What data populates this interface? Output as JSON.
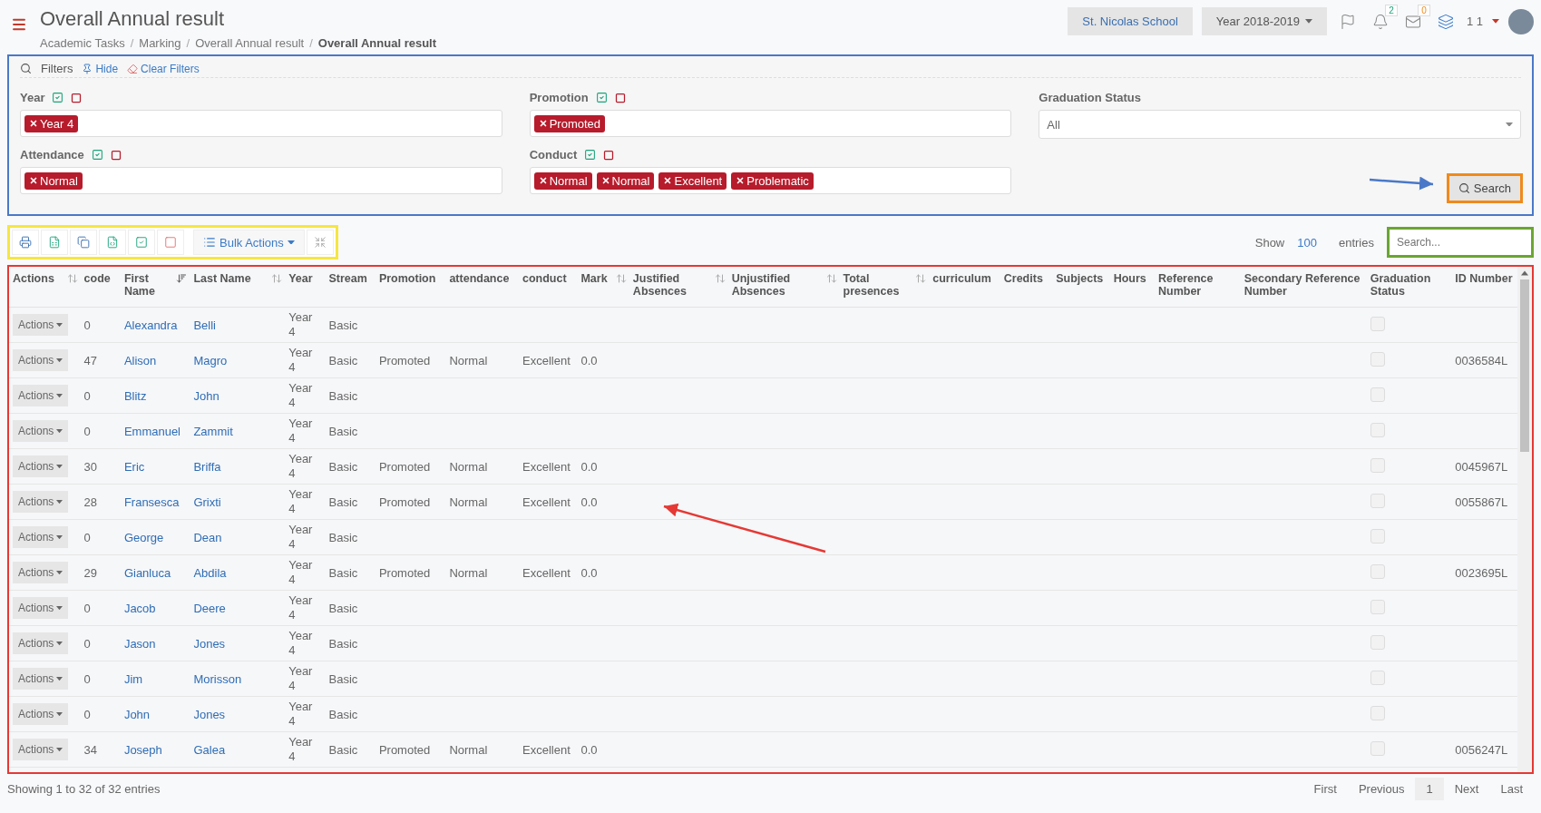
{
  "header": {
    "title": "Overall Annual result",
    "breadcrumbs": [
      {
        "label": "Academic Tasks",
        "current": false
      },
      {
        "separator": "/",
        "label": "Marking",
        "current": false
      },
      {
        "separator": "/",
        "label": "Overall Annual result",
        "current": false
      },
      {
        "separator": "/",
        "label": "Overall Annual result",
        "current": true
      }
    ],
    "school": "St. Nicolas School",
    "year": "Year 2018-2019",
    "notifications": "2",
    "messages": "0",
    "user": "1 1"
  },
  "filters": {
    "title": "Filters",
    "hide": "Hide",
    "clear": "Clear Filters",
    "search_button": "Search",
    "fields": [
      {
        "kind": "tags",
        "label": "Year",
        "tags": [
          "Year 4"
        ]
      },
      {
        "kind": "tags",
        "label": "Promotion",
        "tags": [
          "Promoted"
        ]
      },
      {
        "kind": "select",
        "label": "Graduation Status",
        "value": "All"
      },
      {
        "kind": "tags",
        "label": "Attendance",
        "tags": [
          "Normal"
        ]
      },
      {
        "kind": "tags",
        "label": "Conduct",
        "tags": [
          "Normal",
          "Normal",
          "Excellent",
          "Problematic"
        ]
      }
    ]
  },
  "toolbar": {
    "bulk_actions": "Bulk Actions",
    "show_label": "Show",
    "page_size": "100",
    "entries_label": "entries",
    "search": {
      "placeholder": "Search..."
    }
  },
  "table": {
    "columns": [
      {
        "label": "Actions",
        "sortable": true,
        "sorted": false
      },
      {
        "label": "code",
        "sortable": false
      },
      {
        "label": "First Name",
        "sortable": true,
        "sorted": true
      },
      {
        "label": "Last Name",
        "sortable": true,
        "sorted": false
      },
      {
        "label": "Year",
        "sortable": false
      },
      {
        "label": "Stream",
        "sortable": false
      },
      {
        "label": "Promotion",
        "sortable": false
      },
      {
        "label": "attendance",
        "sortable": false
      },
      {
        "label": "conduct",
        "sortable": false
      },
      {
        "label": "Mark",
        "sortable": true,
        "sorted": false
      },
      {
        "label": "Justified Absences",
        "sortable": true,
        "sorted": false
      },
      {
        "label": "Unjustified Absences",
        "sortable": true,
        "sorted": false
      },
      {
        "label": "Total presences",
        "sortable": true,
        "sorted": false
      },
      {
        "label": "curriculum",
        "sortable": false
      },
      {
        "label": "Credits",
        "sortable": false
      },
      {
        "label": "Subjects",
        "sortable": false
      },
      {
        "label": "Hours",
        "sortable": false
      },
      {
        "label": "Reference Number",
        "sortable": false
      },
      {
        "label": "Secondary Reference Number",
        "sortable": false
      },
      {
        "label": "Graduation Status",
        "sortable": false
      },
      {
        "label": "ID Number",
        "sortable": false
      }
    ],
    "rows": [
      {
        "action": "Actions",
        "code": "0",
        "first": "Alexandra",
        "last": "Belli",
        "year": "Year 4",
        "stream": "Basic",
        "promotion": "",
        "attendance": "",
        "conduct": "",
        "mark": "",
        "graduated": false,
        "id": ""
      },
      {
        "action": "Actions",
        "code": "47",
        "first": "Alison",
        "last": "Magro",
        "year": "Year 4",
        "stream": "Basic",
        "promotion": "Promoted",
        "attendance": "Normal",
        "conduct": "Excellent",
        "mark": "0.0",
        "graduated": false,
        "id": "0036584L"
      },
      {
        "action": "Actions",
        "code": "0",
        "first": "Blitz",
        "last": "John",
        "year": "Year 4",
        "stream": "Basic",
        "promotion": "",
        "attendance": "",
        "conduct": "",
        "mark": "",
        "graduated": false,
        "id": ""
      },
      {
        "action": "Actions",
        "code": "0",
        "first": "Emmanuel",
        "last": "Zammit",
        "year": "Year 4",
        "stream": "Basic",
        "promotion": "",
        "attendance": "",
        "conduct": "",
        "mark": "",
        "graduated": false,
        "id": ""
      },
      {
        "action": "Actions",
        "code": "30",
        "first": "Eric",
        "last": "Briffa",
        "year": "Year 4",
        "stream": "Basic",
        "promotion": "Promoted",
        "attendance": "Normal",
        "conduct": "Excellent",
        "mark": "0.0",
        "graduated": false,
        "id": "0045967L"
      },
      {
        "action": "Actions",
        "code": "28",
        "first": "Fransesca",
        "last": "Grixti",
        "year": "Year 4",
        "stream": "Basic",
        "promotion": "Promoted",
        "attendance": "Normal",
        "conduct": "Excellent",
        "mark": "0.0",
        "graduated": false,
        "id": "0055867L"
      },
      {
        "action": "Actions",
        "code": "0",
        "first": "George",
        "last": "Dean",
        "year": "Year 4",
        "stream": "Basic",
        "promotion": "",
        "attendance": "",
        "conduct": "",
        "mark": "",
        "graduated": false,
        "id": ""
      },
      {
        "action": "Actions",
        "code": "29",
        "first": "Gianluca",
        "last": "Abdila",
        "year": "Year 4",
        "stream": "Basic",
        "promotion": "Promoted",
        "attendance": "Normal",
        "conduct": "Excellent",
        "mark": "0.0",
        "graduated": false,
        "id": "0023695L"
      },
      {
        "action": "Actions",
        "code": "0",
        "first": "Jacob",
        "last": "Deere",
        "year": "Year 4",
        "stream": "Basic",
        "promotion": "",
        "attendance": "",
        "conduct": "",
        "mark": "",
        "graduated": false,
        "id": ""
      },
      {
        "action": "Actions",
        "code": "0",
        "first": "Jason",
        "last": "Jones",
        "year": "Year 4",
        "stream": "Basic",
        "promotion": "",
        "attendance": "",
        "conduct": "",
        "mark": "",
        "graduated": false,
        "id": ""
      },
      {
        "action": "Actions",
        "code": "0",
        "first": "Jim",
        "last": "Morisson",
        "year": "Year 4",
        "stream": "Basic",
        "promotion": "",
        "attendance": "",
        "conduct": "",
        "mark": "",
        "graduated": false,
        "id": ""
      },
      {
        "action": "Actions",
        "code": "0",
        "first": "John",
        "last": "Jones",
        "year": "Year 4",
        "stream": "Basic",
        "promotion": "",
        "attendance": "",
        "conduct": "",
        "mark": "",
        "graduated": false,
        "id": ""
      },
      {
        "action": "Actions",
        "code": "34",
        "first": "Joseph",
        "last": "Galea",
        "year": "Year 4",
        "stream": "Basic",
        "promotion": "Promoted",
        "attendance": "Normal",
        "conduct": "Excellent",
        "mark": "0.0",
        "graduated": false,
        "id": "0056247L"
      }
    ]
  },
  "footer": {
    "summary": "Showing 1 to 32 of 32 entries",
    "pages": [
      {
        "label": "First",
        "selected": false
      },
      {
        "label": "Previous",
        "selected": false
      },
      {
        "label": "1",
        "selected": true
      },
      {
        "label": "Next",
        "selected": false
      },
      {
        "label": "Last",
        "selected": false
      }
    ]
  }
}
